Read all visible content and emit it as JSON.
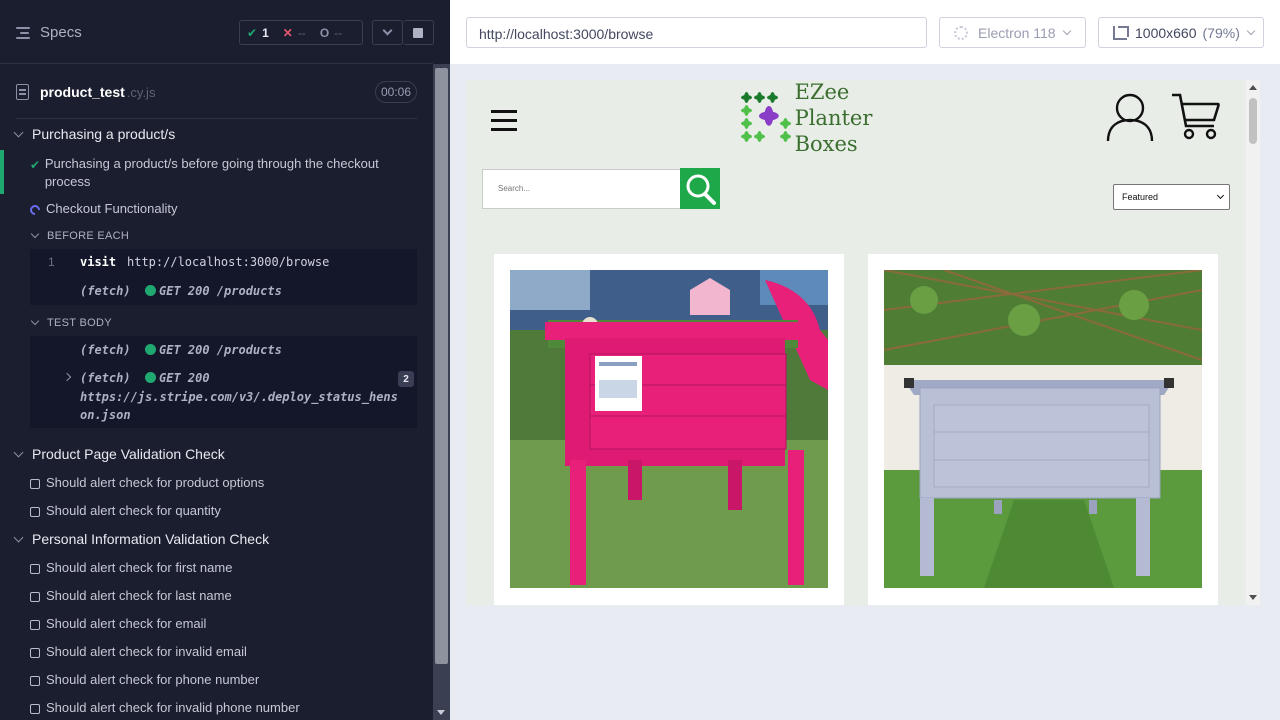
{
  "reporter": {
    "specs_label": "Specs",
    "stats": {
      "passed": "1",
      "failed": "--",
      "pending": "--"
    },
    "spec_file": {
      "name": "product_test",
      "ext": ".cy.js",
      "duration": "00:06"
    },
    "suite1": {
      "title": "Purchasing a product/s",
      "test_passed": "Purchasing a product/s before going through the checkout process",
      "test_running": "Checkout Functionality",
      "before_each_label": "BEFORE EACH",
      "before_each": [
        {
          "num": "1",
          "name": "visit",
          "msg": "http://localhost:3000/browse"
        },
        {
          "num": "",
          "name": "(fetch)",
          "msg": "GET 200 /products"
        }
      ],
      "test_body_label": "TEST BODY",
      "test_body": [
        {
          "name": "(fetch)",
          "msg": "GET 200 /products"
        },
        {
          "name": "(fetch)",
          "msg": "GET 200",
          "url": "https://js.stripe.com/v3/.deploy_status_henson.json",
          "count": "2"
        }
      ]
    },
    "suite2": {
      "title": "Product Page Validation Check",
      "tests": [
        "Should alert check for product options",
        "Should alert check for quantity"
      ]
    },
    "suite3": {
      "title": "Personal Information Validation Check",
      "tests": [
        "Should alert check for first name",
        "Should alert check for last name",
        "Should alert check for email",
        "Should alert check for invalid email",
        "Should alert check for phone number",
        "Should alert check for invalid phone number"
      ]
    }
  },
  "browser": {
    "url": "http://localhost:3000/browse",
    "browser_name": "Electron 118",
    "viewport": "1000x660",
    "zoom": "(79%)"
  },
  "app": {
    "logo_line1": "EZee",
    "logo_line2": "Planter Boxes",
    "search_placeholder": "Search...",
    "sort_selected": "Featured",
    "colors": {
      "brand_green": "#1ea84a",
      "logo_purple": "#8a3ec8",
      "pink_planter": "#e8207a",
      "grey_planter": "#b9c0d6"
    }
  }
}
